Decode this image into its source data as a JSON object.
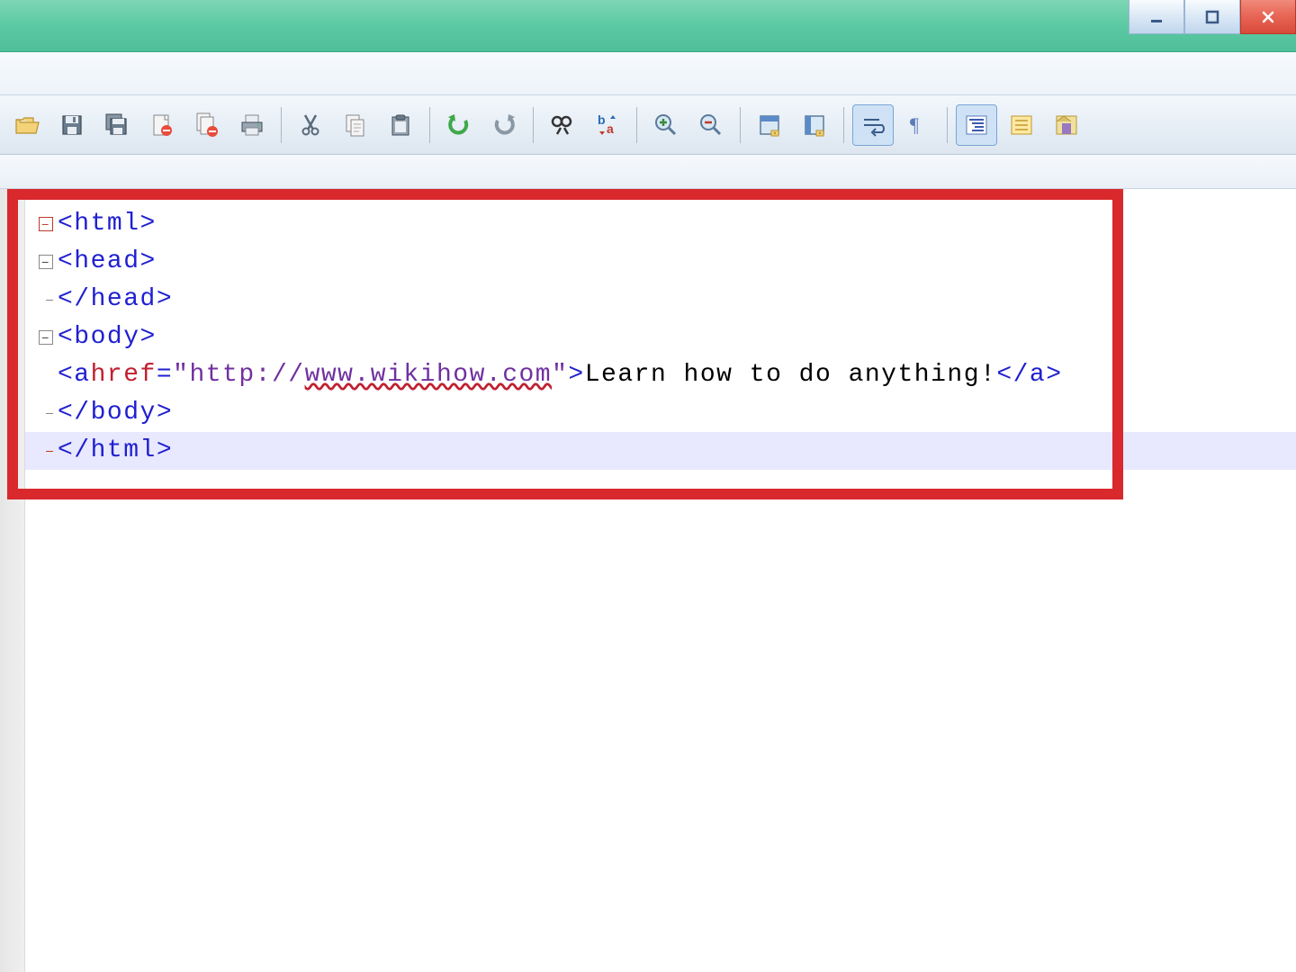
{
  "window_controls": {
    "minimize": "minimize",
    "maximize": "maximize",
    "close": "close"
  },
  "toolbar": {
    "buttons": [
      "open",
      "save",
      "save-all",
      "close-file",
      "close-all",
      "print",
      "sep",
      "cut",
      "copy",
      "paste",
      "sep",
      "undo",
      "redo",
      "sep",
      "find",
      "find-replace",
      "sep",
      "zoom-in",
      "zoom-out",
      "sep",
      "sync-vertical",
      "sync-horizontal",
      "sep",
      "word-wrap",
      "show-all-chars",
      "sep",
      "indent-guide",
      "function-list",
      "folder-view"
    ]
  },
  "code": {
    "line1": "<html>",
    "line2": "<head>",
    "line3": "</head>",
    "line4": "<body>",
    "line5_pre": "<a ",
    "line5_attr": "href",
    "line5_eq": "=",
    "line5_q1": "\"http://",
    "line5_url": "www.wikihow.com",
    "line5_q2": "\"",
    "line5_gt": ">",
    "line5_text": "Learn how to do anything!",
    "line5_close": "</a>",
    "line6": "</body>",
    "line7": "</html>"
  },
  "current_line": 7
}
